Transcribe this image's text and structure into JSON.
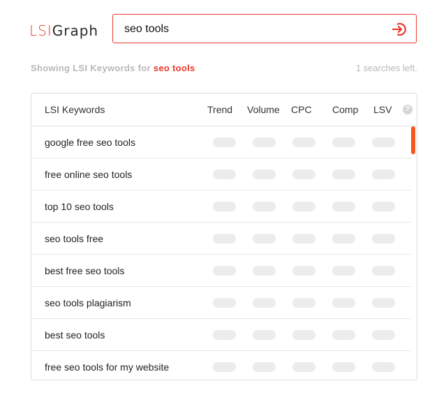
{
  "logo": {
    "lsi": "LSI",
    "graph": "Graph"
  },
  "search": {
    "value": "seo tools",
    "submit_icon": "arrow-enter-circle-icon"
  },
  "status": {
    "prefix": "Showing LSI Keywords for",
    "term": "seo tools",
    "searches_left": "1 searches left."
  },
  "table": {
    "headers": {
      "keywords": "LSI Keywords",
      "trend": "Trend",
      "volume": "Volume",
      "cpc": "CPC",
      "comp": "Comp",
      "lsv": "LSV",
      "help": "?"
    },
    "rows": [
      "google free seo tools",
      "free online seo tools",
      "top 10 seo tools",
      "seo tools free",
      "best free seo tools",
      "seo tools plagiarism",
      "best seo tools",
      "free seo tools for my website"
    ]
  },
  "colors": {
    "accent": "#e8392c",
    "scroll": "#f15a22",
    "placeholder_pill": "#ececec"
  }
}
